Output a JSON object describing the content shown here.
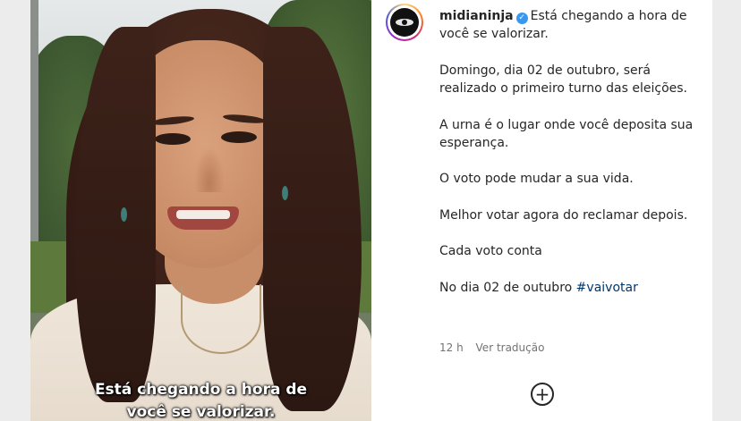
{
  "video": {
    "caption_line1": "Está chegando a hora de",
    "caption_line2": "você se valorizar."
  },
  "post": {
    "username": "midianinja",
    "verified_icon": "verified-badge-icon",
    "accent_color": "#3897f0",
    "hashtag_color": "#00376b",
    "caption_first_line": "Está chegando a hora de você se valorizar.",
    "paragraphs": [
      "Domingo, dia 02 de outubro, será realizado o primeiro turno das eleições.",
      "A urna é o lugar onde você deposita sua esperança.",
      "O voto pode mudar a sua vida.",
      "Melhor votar agora do reclamar depois.",
      "Cada voto conta"
    ],
    "last_line_text": "No dia 02 de outubro",
    "hashtag": "#vaivotar",
    "time_ago": "12 h",
    "translate_link": "Ver tradução",
    "add_icon": "plus-circle-icon"
  }
}
